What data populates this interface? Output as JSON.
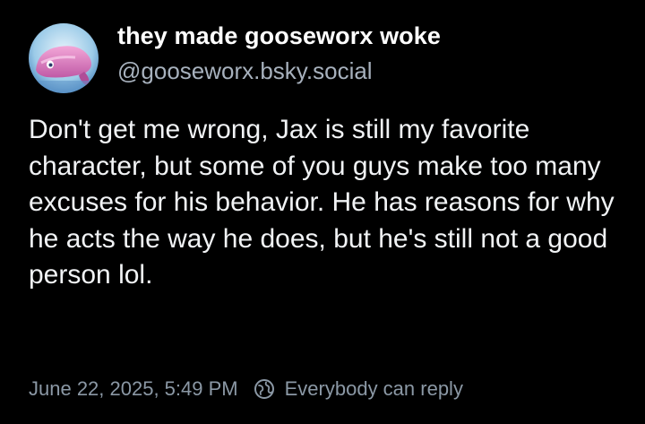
{
  "post": {
    "author": {
      "display_name": "they made gooseworx woke",
      "handle": "@gooseworx.bsky.social"
    },
    "text": "Don't get me wrong, Jax is still my favorite character, but some of you guys make too many excuses for his behavior. He has reasons for why he acts the way he does, but he's still not a good person lol.",
    "timestamp": "June 22, 2025, 5:49 PM",
    "reply_setting": {
      "icon": "globe-icon",
      "label": "Everybody can reply"
    }
  },
  "colors": {
    "background": "#000000",
    "text": "#f1f3f5",
    "handle": "#a7b1bd",
    "meta": "#8b98a5"
  }
}
